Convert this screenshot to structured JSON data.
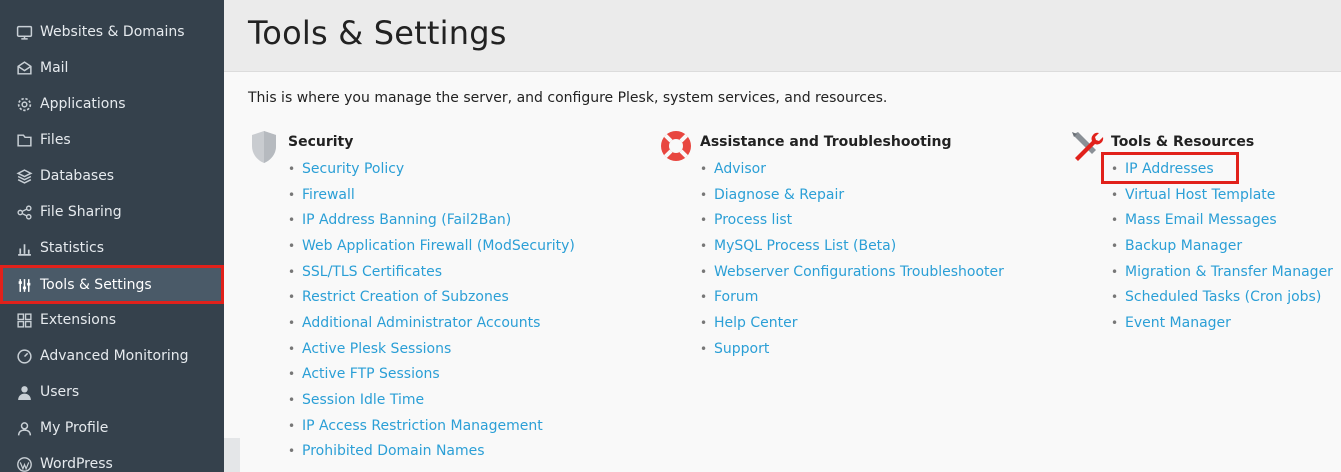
{
  "sidebar": {
    "items": [
      {
        "label": "Websites & Domains",
        "icon": "monitor-icon"
      },
      {
        "label": "Mail",
        "icon": "mail-icon"
      },
      {
        "label": "Applications",
        "icon": "gear-icon"
      },
      {
        "label": "Files",
        "icon": "folder-icon"
      },
      {
        "label": "Databases",
        "icon": "database-icon"
      },
      {
        "label": "File Sharing",
        "icon": "share-icon"
      },
      {
        "label": "Statistics",
        "icon": "bar-chart-icon"
      },
      {
        "label": "Tools & Settings",
        "icon": "sliders-icon",
        "active": true
      },
      {
        "label": "Extensions",
        "icon": "extensions-icon"
      },
      {
        "label": "Advanced Monitoring",
        "icon": "monitoring-icon"
      },
      {
        "label": "Users",
        "icon": "user-icon"
      },
      {
        "label": "My Profile",
        "icon": "profile-icon"
      },
      {
        "label": "WordPress",
        "icon": "wordpress-icon"
      }
    ]
  },
  "main": {
    "title": "Tools & Settings",
    "intro": "This is where you manage the server, and configure Plesk, system services, and resources.",
    "groups": {
      "security": {
        "title": "Security",
        "icon": "shield-icon",
        "links": [
          "Security Policy",
          "Firewall",
          "IP Address Banning (Fail2Ban)",
          "Web Application Firewall (ModSecurity)",
          "SSL/TLS Certificates",
          "Restrict Creation of Subzones",
          "Additional Administrator Accounts",
          "Active Plesk Sessions",
          "Active FTP Sessions",
          "Session Idle Time",
          "IP Access Restriction Management",
          "Prohibited Domain Names"
        ]
      },
      "assistance": {
        "title": "Assistance and Troubleshooting",
        "icon": "lifebuoy-icon",
        "links": [
          "Advisor",
          "Diagnose & Repair",
          "Process list",
          "MySQL Process List (Beta)",
          "Webserver Configurations Troubleshooter",
          "Forum",
          "Help Center",
          "Support"
        ]
      },
      "tools": {
        "title": "Tools & Resources",
        "icon": "tools-icon",
        "links": [
          "IP Addresses",
          "Virtual Host Template",
          "Mass Email Messages",
          "Backup Manager",
          "Migration & Transfer Manager",
          "Scheduled Tasks (Cron jobs)",
          "Event Manager"
        ]
      }
    }
  },
  "colors": {
    "sidebar_bg": "#35414c",
    "link": "#2b9fd6",
    "highlight": "#e1211b"
  }
}
